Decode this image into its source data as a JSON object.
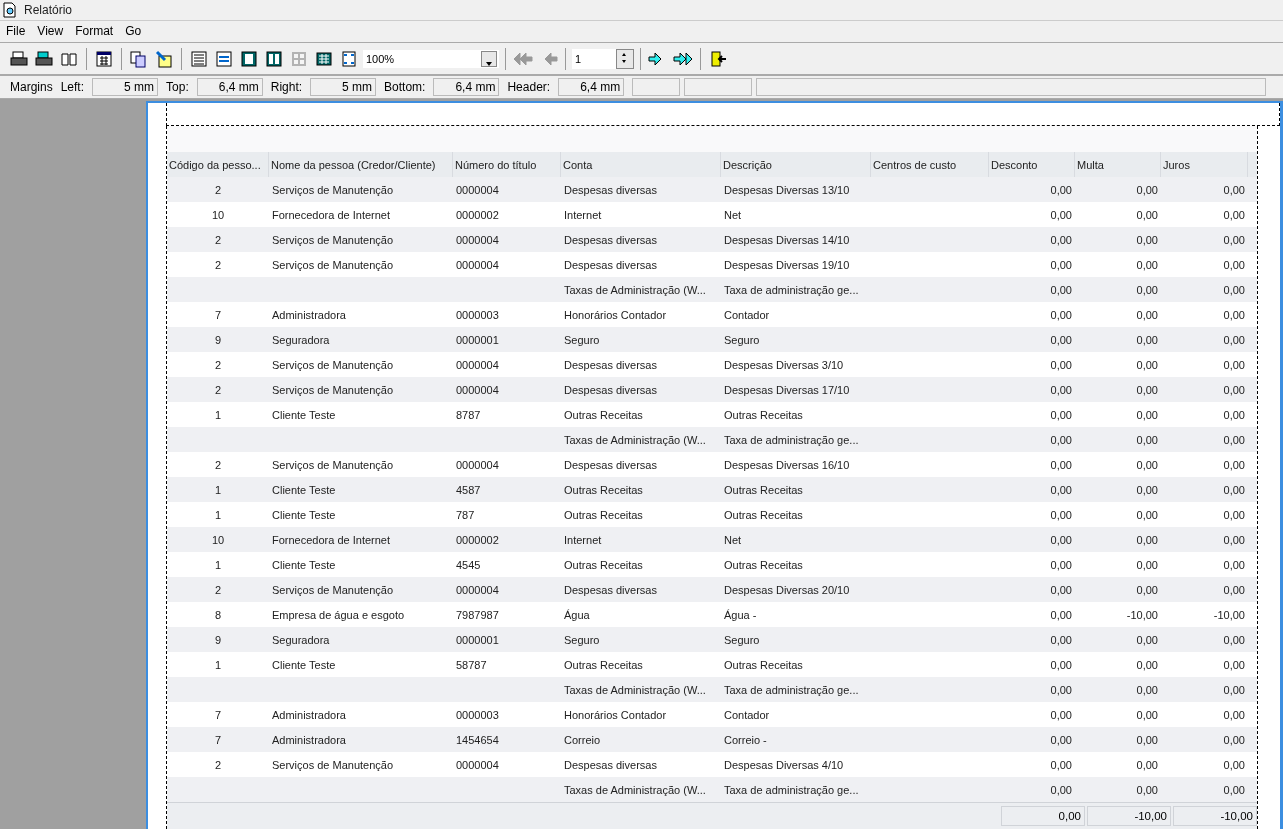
{
  "window": {
    "title": "Relatório"
  },
  "menu": [
    "File",
    "View",
    "Format",
    "Go"
  ],
  "toolbar": [
    {
      "kind": "print",
      "disabled": false
    },
    {
      "kind": "print-setup",
      "disabled": false
    },
    {
      "kind": "book",
      "disabled": false
    },
    {
      "kind": "sep"
    },
    {
      "kind": "grid",
      "disabled": false
    },
    {
      "kind": "sep"
    },
    {
      "kind": "copy",
      "disabled": false
    },
    {
      "kind": "paint",
      "disabled": false
    },
    {
      "kind": "sep"
    },
    {
      "kind": "lines",
      "disabled": false
    },
    {
      "kind": "fit-width",
      "disabled": false
    },
    {
      "kind": "one-page",
      "disabled": false
    },
    {
      "kind": "two-pages",
      "disabled": false
    },
    {
      "kind": "four-pages",
      "disabled": true
    },
    {
      "kind": "many-pages",
      "disabled": false
    },
    {
      "kind": "zoom-fit",
      "disabled": false
    }
  ],
  "zoom": {
    "value": "100%"
  },
  "navigation": {
    "first_disabled": true,
    "prev_disabled": true,
    "page": "1",
    "next_disabled": false,
    "last_disabled": false
  },
  "margins": {
    "label": "Margins",
    "fields": [
      {
        "label": "Left:",
        "value": "5 mm"
      },
      {
        "label": "Top:",
        "value": "6,4 mm"
      },
      {
        "label": "Right:",
        "value": "5 mm"
      },
      {
        "label": "Bottom:",
        "value": "6,4 mm"
      },
      {
        "label": "Header:",
        "value": "6,4 mm"
      }
    ]
  },
  "table": {
    "columns": [
      "Código da pesso...",
      "Nome da pessoa (Credor/Cliente)",
      "Número do título",
      "Conta",
      "Descrição",
      "Centros de custo",
      "Desconto",
      "Multa",
      "Juros"
    ],
    "rows": [
      [
        "2",
        "Serviços de Manutenção",
        "0000004",
        "Despesas diversas",
        "Despesas Diversas 13/10",
        "",
        "0,00",
        "0,00",
        "0,00"
      ],
      [
        "10",
        "Fornecedora de Internet",
        "0000002",
        "Internet",
        "Net",
        "",
        "0,00",
        "0,00",
        "0,00"
      ],
      [
        "2",
        "Serviços de Manutenção",
        "0000004",
        "Despesas diversas",
        "Despesas Diversas 14/10",
        "",
        "0,00",
        "0,00",
        "0,00"
      ],
      [
        "2",
        "Serviços de Manutenção",
        "0000004",
        "Despesas diversas",
        "Despesas Diversas 19/10",
        "",
        "0,00",
        "0,00",
        "0,00"
      ],
      [
        "",
        "",
        "",
        "Taxas de Administração (W...",
        "Taxa de administração ge...",
        "",
        "0,00",
        "0,00",
        "0,00"
      ],
      [
        "7",
        "Administradora",
        "0000003",
        "Honorários Contador",
        "Contador",
        "",
        "0,00",
        "0,00",
        "0,00"
      ],
      [
        "9",
        "Seguradora",
        "0000001",
        "Seguro",
        "Seguro",
        "",
        "0,00",
        "0,00",
        "0,00"
      ],
      [
        "2",
        "Serviços de Manutenção",
        "0000004",
        "Despesas diversas",
        "Despesas Diversas 3/10",
        "",
        "0,00",
        "0,00",
        "0,00"
      ],
      [
        "2",
        "Serviços de Manutenção",
        "0000004",
        "Despesas diversas",
        "Despesas Diversas 17/10",
        "",
        "0,00",
        "0,00",
        "0,00"
      ],
      [
        "1",
        "Cliente Teste",
        "8787",
        "Outras Receitas",
        "Outras Receitas",
        "",
        "0,00",
        "0,00",
        "0,00"
      ],
      [
        "",
        "",
        "",
        "Taxas de Administração (W...",
        "Taxa de administração ge...",
        "",
        "0,00",
        "0,00",
        "0,00"
      ],
      [
        "2",
        "Serviços de Manutenção",
        "0000004",
        "Despesas diversas",
        "Despesas Diversas 16/10",
        "",
        "0,00",
        "0,00",
        "0,00"
      ],
      [
        "1",
        "Cliente Teste",
        "4587",
        "Outras Receitas",
        "Outras Receitas",
        "",
        "0,00",
        "0,00",
        "0,00"
      ],
      [
        "1",
        "Cliente Teste",
        "787",
        "Outras Receitas",
        "Outras Receitas",
        "",
        "0,00",
        "0,00",
        "0,00"
      ],
      [
        "10",
        "Fornecedora de Internet",
        "0000002",
        "Internet",
        "Net",
        "",
        "0,00",
        "0,00",
        "0,00"
      ],
      [
        "1",
        "Cliente Teste",
        "4545",
        "Outras Receitas",
        "Outras Receitas",
        "",
        "0,00",
        "0,00",
        "0,00"
      ],
      [
        "2",
        "Serviços de Manutenção",
        "0000004",
        "Despesas diversas",
        "Despesas Diversas 20/10",
        "",
        "0,00",
        "0,00",
        "0,00"
      ],
      [
        "8",
        "Empresa de água e esgoto",
        "7987987",
        "Água",
        "Água -",
        "",
        "0,00",
        "-10,00",
        "-10,00"
      ],
      [
        "9",
        "Seguradora",
        "0000001",
        "Seguro",
        "Seguro",
        "",
        "0,00",
        "0,00",
        "0,00"
      ],
      [
        "1",
        "Cliente Teste",
        "58787",
        "Outras Receitas",
        "Outras Receitas",
        "",
        "0,00",
        "0,00",
        "0,00"
      ],
      [
        "",
        "",
        "",
        "Taxas de Administração (W...",
        "Taxa de administração ge...",
        "",
        "0,00",
        "0,00",
        "0,00"
      ],
      [
        "7",
        "Administradora",
        "0000003",
        "Honorários Contador",
        "Contador",
        "",
        "0,00",
        "0,00",
        "0,00"
      ],
      [
        "7",
        "Administradora",
        "1454654",
        "Correio",
        "Correio -",
        "",
        "0,00",
        "0,00",
        "0,00"
      ],
      [
        "2",
        "Serviços de Manutenção",
        "0000004",
        "Despesas diversas",
        "Despesas Diversas 4/10",
        "",
        "0,00",
        "0,00",
        "0,00"
      ],
      [
        "",
        "",
        "",
        "Taxas de Administração (W...",
        "Taxa de administração ge...",
        "",
        "0,00",
        "0,00",
        "0,00"
      ]
    ],
    "totals": [
      "0,00",
      "-10,00",
      "-10,00"
    ]
  }
}
